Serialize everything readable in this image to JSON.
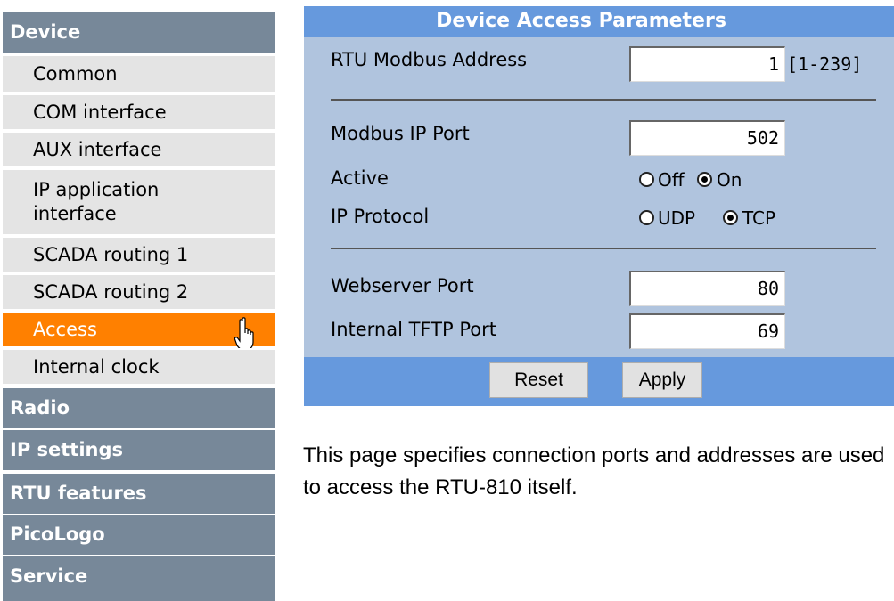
{
  "sidebar": {
    "sections": [
      {
        "label": "Device"
      },
      {
        "label": "Radio"
      },
      {
        "label": "IP settings"
      },
      {
        "label": "RTU features"
      },
      {
        "label": "PicoLogo"
      },
      {
        "label": "Service"
      }
    ],
    "device_items": [
      {
        "label": "Common"
      },
      {
        "label": "COM interface"
      },
      {
        "label": "AUX interface"
      },
      {
        "label": "IP application interface"
      },
      {
        "label": "SCADA routing 1"
      },
      {
        "label": "SCADA routing 2"
      },
      {
        "label": "Access",
        "active": true
      },
      {
        "label": "Internal clock"
      }
    ]
  },
  "panel": {
    "title": "Device Access Parameters",
    "rtu_address": {
      "label": "RTU Modbus Address",
      "value": "1",
      "range": "[1-239]"
    },
    "modbus_port": {
      "label": "Modbus IP Port",
      "value": "502"
    },
    "active": {
      "label": "Active",
      "options": [
        "Off",
        "On"
      ],
      "selected": "On"
    },
    "ip_protocol": {
      "label": "IP Protocol",
      "options": [
        "UDP",
        "TCP"
      ],
      "selected": "TCP"
    },
    "webserver_port": {
      "label": "Webserver Port",
      "value": "80"
    },
    "tftp_port": {
      "label": "Internal TFTP Port",
      "value": "69"
    },
    "buttons": {
      "reset": "Reset",
      "apply": "Apply"
    }
  },
  "description": "This page specifies connection ports and addresses are used to access the RTU-810 itself.",
  "colors": {
    "accent": "#ff8000",
    "section_bg": "#778899",
    "panel_bg": "#b0c4de",
    "header_bg": "#6699dd"
  }
}
